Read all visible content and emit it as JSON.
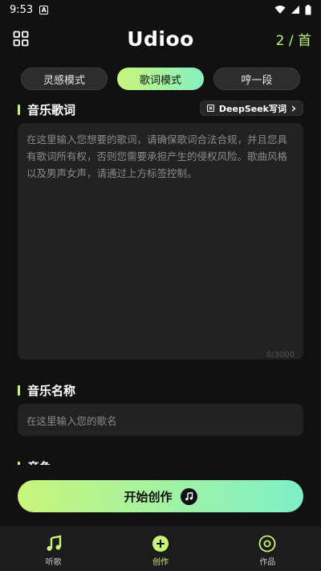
{
  "status": {
    "time": "9:53",
    "app_icon_letter": "A"
  },
  "header": {
    "title": "Udioo",
    "counter": "2 / 首"
  },
  "tabs": [
    {
      "label": "灵感模式",
      "active": false
    },
    {
      "label": "歌词模式",
      "active": true
    },
    {
      "label": "哼一段",
      "active": false
    }
  ],
  "lyrics": {
    "section_title": "音乐歌词",
    "deepseek_label": "DeepSeek写词",
    "placeholder": "在这里输入您想要的歌词，请确保歌词合法合规，并且您具有歌词所有权，否则您需要承担产生的侵权风险。歌曲风格以及男声女声，请通过上方标签控制。",
    "char_count": "0/3000"
  },
  "music_name": {
    "section_title": "音乐名称",
    "placeholder": "在这里输入您的歌名"
  },
  "next_section": {
    "section_title": "音色"
  },
  "start_button": {
    "label": "开始创作"
  },
  "nav": [
    {
      "label": "听歌",
      "icon": "music-note-icon"
    },
    {
      "label": "创作",
      "icon": "plus-circle-icon"
    },
    {
      "label": "作品",
      "icon": "disc-icon"
    }
  ],
  "colors": {
    "accent_start": "#c9f57b",
    "accent_end": "#7ef0c8",
    "background": "#111111"
  }
}
